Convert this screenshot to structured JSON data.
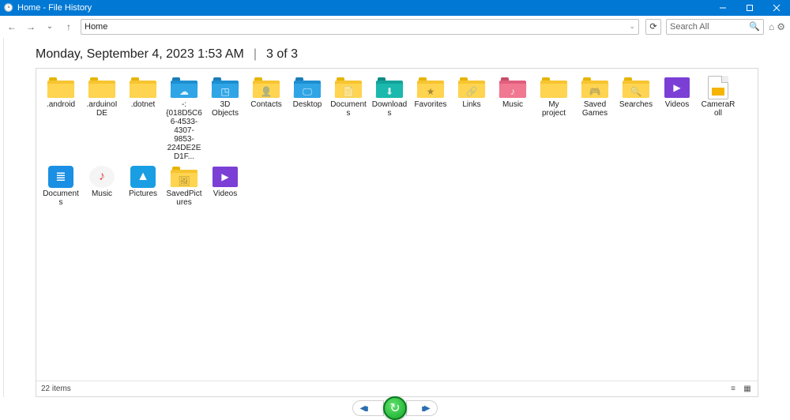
{
  "window": {
    "title": "Home - File History"
  },
  "toolbar": {
    "location": "Home",
    "search_placeholder": "Search All"
  },
  "header": {
    "datetime": "Monday, September 4, 2023 1:53 AM",
    "position": "3 of 3"
  },
  "items": [
    {
      "label": ".android",
      "kind": "folder-yellow"
    },
    {
      "label": ".arduinoIDE",
      "kind": "folder-yellow"
    },
    {
      "label": ".dotnet",
      "kind": "folder-yellow"
    },
    {
      "label": "-:{018D5C66-4533-4307-9853-224DE2ED1F...",
      "kind": "folder-blue",
      "glyph": "☁"
    },
    {
      "label": "3D Objects",
      "kind": "folder-blue",
      "glyph": "◳"
    },
    {
      "label": "Contacts",
      "kind": "folder-yellow",
      "glyph": "👤"
    },
    {
      "label": "Desktop",
      "kind": "folder-blue",
      "glyph": "🖵"
    },
    {
      "label": "Documents",
      "kind": "folder-yellow",
      "glyph": "📄"
    },
    {
      "label": "Downloads",
      "kind": "folder-teal",
      "glyph": "⬇"
    },
    {
      "label": "Favorites",
      "kind": "folder-yellow",
      "glyph": "★"
    },
    {
      "label": "Links",
      "kind": "folder-yellow",
      "glyph": "🔗"
    },
    {
      "label": "Music",
      "kind": "folder-pink",
      "glyph": "♪"
    },
    {
      "label": "My project",
      "kind": "folder-yellow"
    },
    {
      "label": "Saved Games",
      "kind": "folder-yellow",
      "glyph": "🎮"
    },
    {
      "label": "Searches",
      "kind": "folder-yellow",
      "glyph": "🔍"
    },
    {
      "label": "Videos",
      "kind": "video-tile",
      "glyph": "▶"
    },
    {
      "label": "CameraRoll",
      "kind": "file-camera"
    },
    {
      "label": "Documents",
      "kind": "lib-docs",
      "glyph": "📄"
    },
    {
      "label": "Music",
      "kind": "lib-music",
      "glyph": "♪"
    },
    {
      "label": "Pictures",
      "kind": "lib-pics",
      "glyph": "🖼"
    },
    {
      "label": "SavedPictures",
      "kind": "folder-yellow",
      "glyph": "🖼"
    },
    {
      "label": "Videos",
      "kind": "video-tile",
      "glyph": "▶"
    }
  ],
  "status": {
    "count": "22 items"
  }
}
